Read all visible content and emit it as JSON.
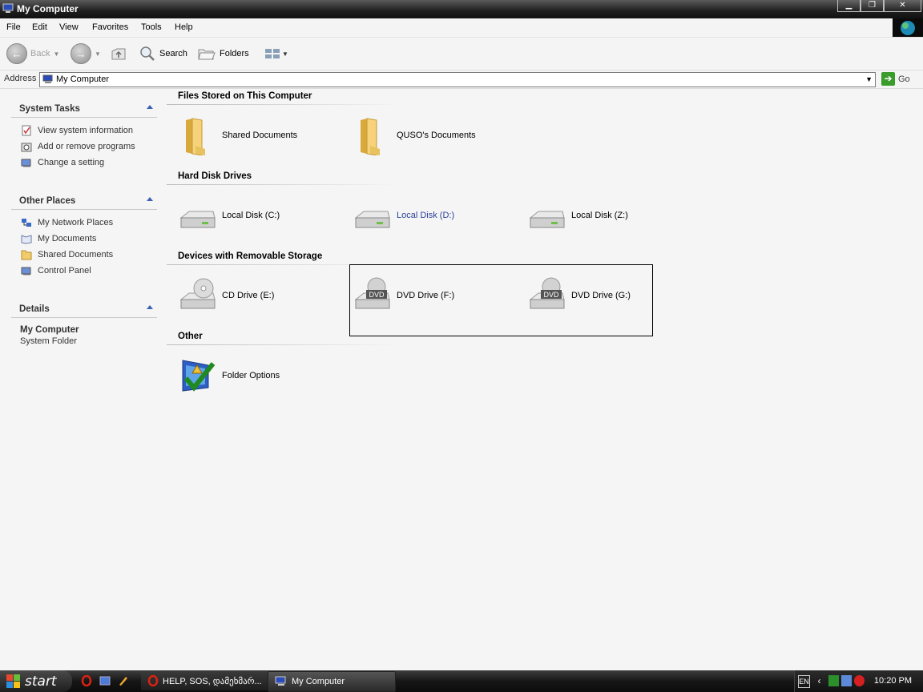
{
  "window": {
    "title": "My Computer",
    "controls": [
      "minimize",
      "restore",
      "close"
    ]
  },
  "menu": [
    "File",
    "Edit",
    "View",
    "Favorites",
    "Tools",
    "Help"
  ],
  "toolbar": {
    "back": "Back",
    "search": "Search",
    "folders": "Folders"
  },
  "address": {
    "label": "Address",
    "value": "My Computer",
    "go": "Go"
  },
  "sidebar": {
    "system_tasks": {
      "title": "System Tasks",
      "items": [
        "View system information",
        "Add or remove programs",
        "Change a setting"
      ]
    },
    "other_places": {
      "title": "Other Places",
      "items": [
        "My Network Places",
        "My Documents",
        "Shared Documents",
        "Control Panel"
      ]
    },
    "details": {
      "title": "Details",
      "name": "My Computer",
      "type": "System Folder"
    }
  },
  "groups": [
    {
      "title": "Files Stored on This Computer",
      "items": [
        "Shared Documents",
        "QUSO's Documents"
      ]
    },
    {
      "title": "Hard Disk Drives",
      "items": [
        "Local Disk (C:)",
        "Local Disk (D:)",
        "Local Disk (Z:)"
      ]
    },
    {
      "title": "Devices with Removable Storage",
      "items": [
        "CD Drive (E:)",
        "DVD Drive (F:)",
        "DVD Drive (G:)"
      ]
    },
    {
      "title": "Other",
      "items": [
        "Folder Options"
      ]
    }
  ],
  "taskbar": {
    "start": "start",
    "tasks": [
      "HELP, SOS, დამეხმარ...",
      "My Computer"
    ],
    "language": "EN",
    "clock": "10:20 PM"
  },
  "colors": {
    "link": "#2a3f9a",
    "panel_arrow": "#3b62b5",
    "go_green": "#3a9c2b"
  }
}
